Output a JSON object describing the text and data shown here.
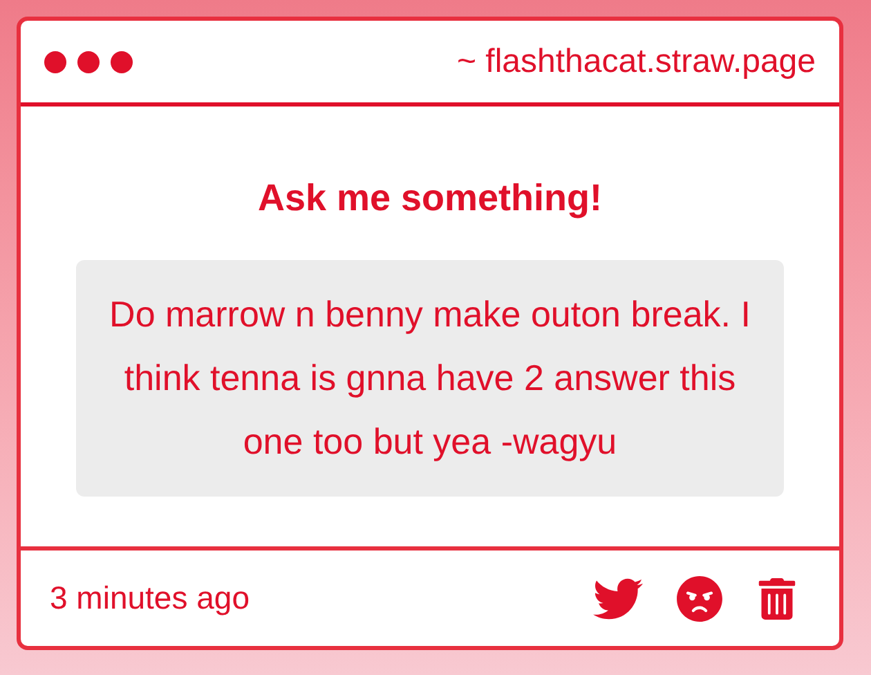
{
  "window": {
    "title": "~ flashthacat.straw.page"
  },
  "heading": "Ask me something!",
  "question": "Do marrow n benny make outon break. I think tenna is gnna have 2 answer this one too but yea -wagyu",
  "footer": {
    "time": "3 minutes ago",
    "actions": [
      {
        "kind": "twitter"
      },
      {
        "kind": "angry"
      },
      {
        "kind": "delete"
      }
    ]
  }
}
